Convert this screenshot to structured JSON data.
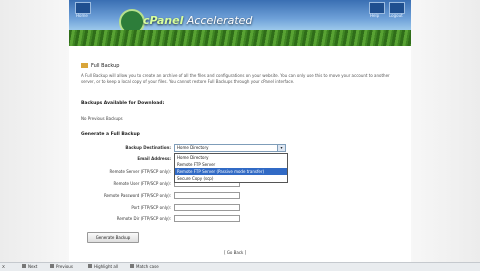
{
  "header": {
    "logo_text_pre": "cPanel",
    "logo_text_post": "Accelerated",
    "left_icon_label": "Home",
    "right_icon_labels": [
      "Help",
      "Logout"
    ]
  },
  "page": {
    "title": "Full Backup",
    "intro": "A Full Backup will allow you to create an archive of all the files and configurations on your website. You can only use this to move your account to another server, or to keep a local copy of your files. You cannot restore Full Backups through your cPanel interface.",
    "available_heading": "Backups Available for Download:",
    "no_previous": "No Previous Backups",
    "generate_heading": "Generate a Full Backup",
    "form": {
      "destination_label": "Backup Destination:",
      "destination_value": "Home Directory",
      "email_label": "Email Address:",
      "remote_server_label": "Remote Server (FTP/SCP only):",
      "remote_user_label": "Remote User (FTP/SCP only):",
      "remote_password_label": "Remote Password (FTP/SCP only):",
      "port_label": "Port (FTP/SCP only):",
      "remote_dir_label": "Remote Dir (FTP/SCP only):"
    },
    "dropdown_options": [
      "Home Directory",
      "Remote FTP Server",
      "Remote FTP Server (Passive mode transfer)",
      "Secure Copy (scp)"
    ],
    "generate_button": "Generate Backup",
    "go_back": "[ Go Back ]"
  },
  "bottom_bar": {
    "close": "x",
    "items": [
      "Next",
      "Previous",
      "Highlight all",
      "Match case"
    ]
  }
}
